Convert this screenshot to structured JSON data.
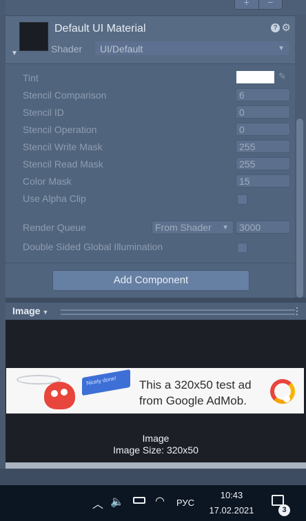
{
  "toolbar": {
    "plus": "+",
    "minus": "−"
  },
  "material": {
    "title": "Default UI Material",
    "shader_label": "Shader",
    "shader_value": "UI/Default"
  },
  "properties": [
    {
      "label": "Tint"
    },
    {
      "label": "Stencil Comparison",
      "value": "6"
    },
    {
      "label": "Stencil ID",
      "value": "0"
    },
    {
      "label": "Stencil Operation",
      "value": "0"
    },
    {
      "label": "Stencil Write Mask",
      "value": "255"
    },
    {
      "label": "Stencil Read Mask",
      "value": "255"
    },
    {
      "label": "Color Mask",
      "value": "15"
    },
    {
      "label": "Use Alpha Clip"
    }
  ],
  "render_queue": {
    "label": "Render Queue",
    "mode": "From Shader",
    "value": "3000"
  },
  "double_sided": {
    "label": "Double Sided Global Illumination"
  },
  "add_component": "Add Component",
  "preview": {
    "tab_label": "Image",
    "ad_line1": "This a 320x50 test ad",
    "ad_line2": "from Google AdMob.",
    "flag_text": "Nicely done!",
    "caption_title": "Image",
    "caption_size": "Image Size: 320x50"
  },
  "taskbar": {
    "language": "РУС",
    "time": "10:43",
    "date": "17.02.2021",
    "notification_count": "3"
  },
  "colors": {
    "tint": "#ffffff",
    "ad_red": "#e8453c",
    "ad_yellow": "#f7b500"
  }
}
